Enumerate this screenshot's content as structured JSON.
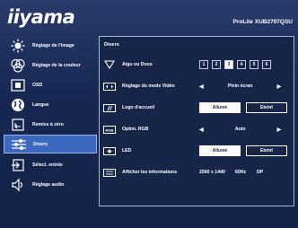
{
  "header": {
    "brand": "iiyama",
    "model": "ProLite XUB2797QSU"
  },
  "sidebar": {
    "items": [
      {
        "label": "Réglage de l'image",
        "icon": "image-adjust-icon"
      },
      {
        "label": "Réglage de la couleur",
        "icon": "color-icon"
      },
      {
        "label": "OSD",
        "icon": "osd-icon"
      },
      {
        "label": "Langue",
        "icon": "globe-icon"
      },
      {
        "label": "Remise à zéro",
        "icon": "reset-icon"
      },
      {
        "label": "Divers",
        "icon": "settings-icon",
        "active": true
      },
      {
        "label": "Sélect. entrée",
        "icon": "input-icon"
      },
      {
        "label": "Réglage audio",
        "icon": "speaker-icon"
      }
    ]
  },
  "panel": {
    "title": "Divers",
    "sharpness": {
      "label": "Aigu ou Doux",
      "levels": [
        "1",
        "2",
        "3",
        "4",
        "5",
        "6"
      ],
      "selected": "3"
    },
    "video_mode": {
      "label": "Réglage du mode Vidéo",
      "value": "Plein écran"
    },
    "logo": {
      "label": "Logo d'accueil",
      "on": "Allumé",
      "off": "Eteint",
      "selected": "on"
    },
    "rgb_range": {
      "label": "Optim. RGB",
      "value": "Auto"
    },
    "led": {
      "label": "LED",
      "on": "Allumé",
      "off": "Eteint",
      "selected": "on"
    },
    "info": {
      "label": "Afficher les informations",
      "resolution": "2560 x 1440",
      "refresh": "60Hz",
      "port": "DP"
    }
  },
  "colors": {
    "background": "#172752",
    "highlight": "#3d68c0",
    "text": "#ffffff"
  }
}
